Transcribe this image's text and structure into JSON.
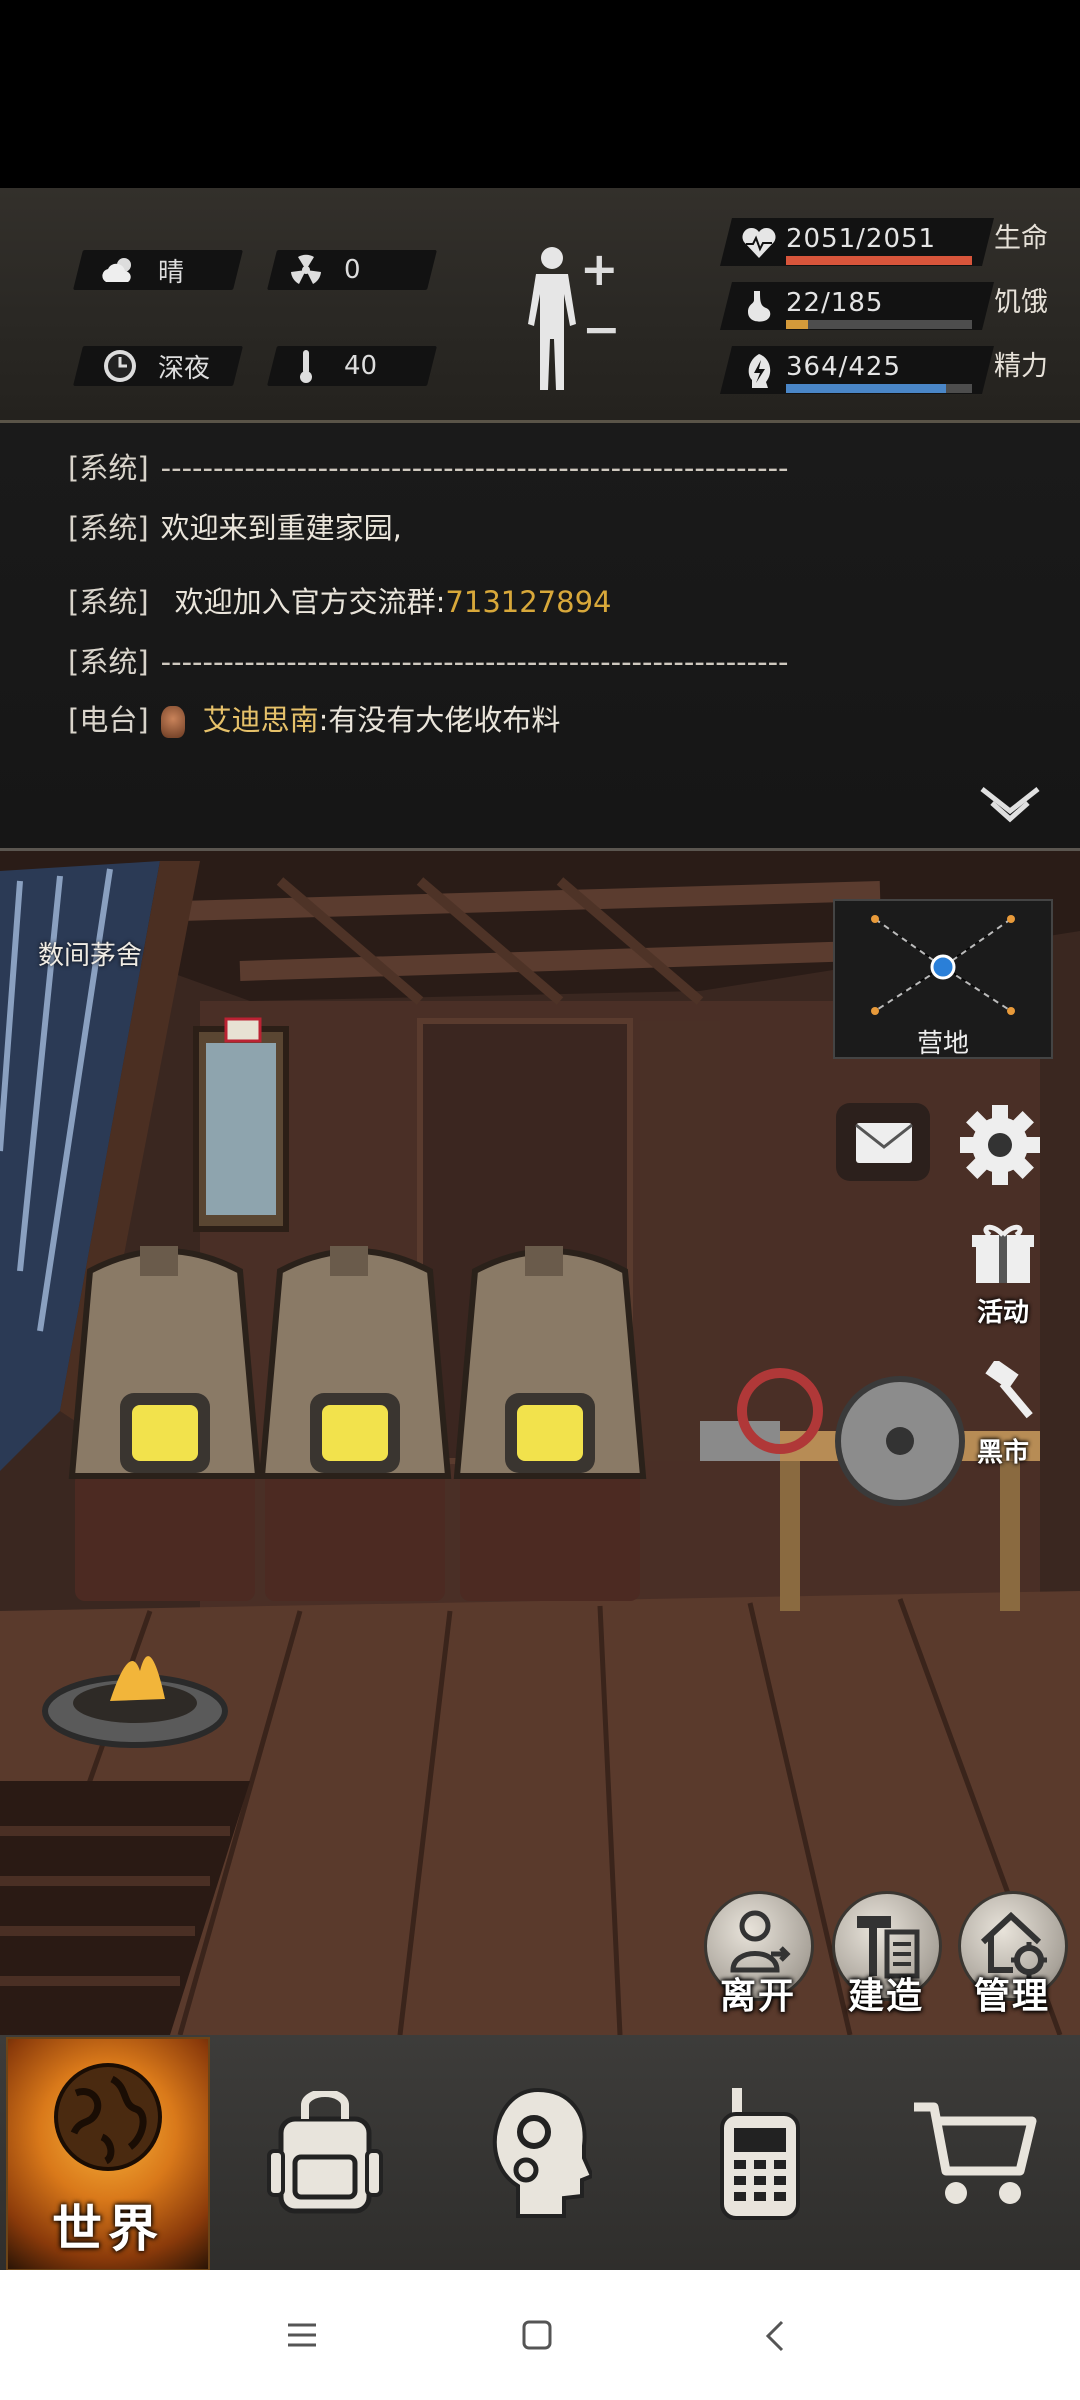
{
  "status": {
    "weather": {
      "icon": "cloud-sun-icon",
      "label": "晴"
    },
    "radiation": {
      "icon": "radiation-icon",
      "value": "0"
    },
    "time": {
      "icon": "clock-icon",
      "label": "深夜"
    },
    "temperature": {
      "icon": "thermometer-icon",
      "value": "40"
    },
    "body": {
      "icon": "body-silhouette-icon",
      "plus": "+",
      "minus": "−"
    },
    "stats": [
      {
        "key": "life",
        "icon": "heart-pulse-icon",
        "value": "2051/2051",
        "label": "生命",
        "fraction": 1.0,
        "color": "#d8553b"
      },
      {
        "key": "hunger",
        "icon": "stomach-icon",
        "value": "22/185",
        "label": "饥饿",
        "fraction": 0.12,
        "color": "#d49a3a"
      },
      {
        "key": "energy",
        "icon": "energy-icon",
        "value": "364/425",
        "label": "精力",
        "fraction": 0.86,
        "color": "#4a86c7"
      }
    ]
  },
  "log": {
    "lines": [
      {
        "tag": "[系统]",
        "text": "------------------------------------------------------------"
      },
      {
        "tag": "[系统]",
        "text": "欢迎来到重建家园,"
      },
      {
        "tag": "[系统]",
        "text": "欢迎加入官方交流群:",
        "highlight": "713127894"
      },
      {
        "tag": "[系统]",
        "text": "------------------------------------------------------------"
      },
      {
        "tag": "[电台]",
        "name": "艾迪思南",
        "text": ":有没有大佬收布料"
      }
    ],
    "collapse_icon": "double-chevron-down-icon"
  },
  "scene": {
    "location": "数间茅舍",
    "minimap_label": "营地",
    "side_buttons": {
      "mail_icon": "mail-icon",
      "settings_icon": "gear-icon",
      "event_label": "活动",
      "event_icon": "gift-icon",
      "market_label": "黑市",
      "market_icon": "gavel-icon"
    },
    "actions": [
      {
        "key": "leave",
        "label": "离开",
        "icon": "person-exit-icon"
      },
      {
        "key": "build",
        "label": "建造",
        "icon": "hammer-build-icon"
      },
      {
        "key": "manage",
        "label": "管理",
        "icon": "house-gear-icon"
      }
    ]
  },
  "tabs": {
    "world_label": "世界",
    "icons": [
      "globe-icon",
      "backpack-icon",
      "brain-gear-icon",
      "radio-icon",
      "shopping-cart-icon"
    ]
  },
  "navbar": {
    "icons": [
      "menu-icon",
      "home-square-icon",
      "back-icon"
    ]
  }
}
